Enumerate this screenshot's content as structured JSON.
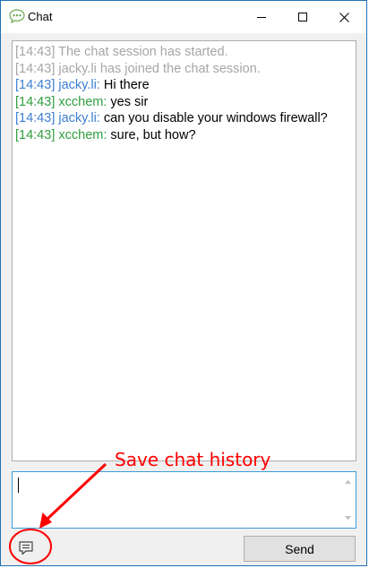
{
  "window": {
    "title": "Chat",
    "controls": {
      "minimize": "minimize-icon",
      "maximize": "maximize-icon",
      "close": "close-icon"
    }
  },
  "chat": {
    "lines": [
      {
        "time": "[14:43]",
        "text": "The chat session has started.",
        "type": "system"
      },
      {
        "time": "[14:43]",
        "text": "jacky.li has joined the chat session.",
        "type": "system"
      },
      {
        "time": "[14:43]",
        "sender": "jacky.li:",
        "text": "Hi there",
        "type": "message",
        "color": "#3c7fd1"
      },
      {
        "time": "[14:43]",
        "sender": "xcchem:",
        "text": "yes sir",
        "type": "message",
        "color": "#2f9e3e"
      },
      {
        "time": "[14:43]",
        "sender": "jacky.li:",
        "text": "can you disable your windows firewall?",
        "type": "message",
        "color": "#3c7fd1"
      },
      {
        "time": "[14:43]",
        "sender": "xcchem:",
        "text": "sure, but how?",
        "type": "message",
        "color": "#2f9e3e"
      }
    ]
  },
  "input": {
    "value": ""
  },
  "toolbar": {
    "history_icon": "chat-history-icon",
    "send_label": "Send"
  },
  "annotation": {
    "text": "Save chat history",
    "color": "#ff0000"
  }
}
